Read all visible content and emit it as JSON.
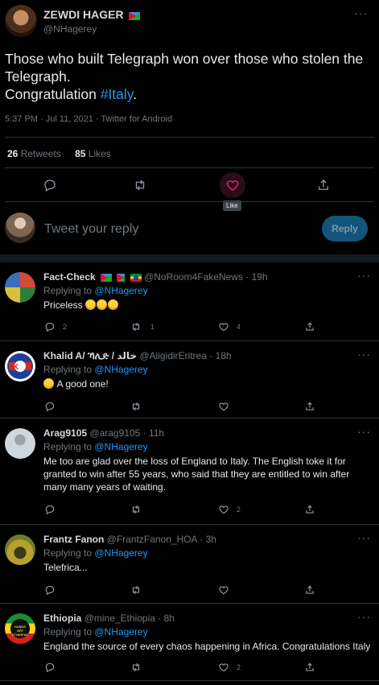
{
  "main_tweet": {
    "author_name": "ZEWDI HAGER",
    "author_handle": "@NHagerey",
    "text_line1": "Those who built Telegraph won over those who stolen the Telegraph.",
    "text_line2_prefix": "Congratulation ",
    "hashtag": "#Italy",
    "text_line2_suffix": ".",
    "timestamp": "5:37 PM · Jul 11, 2021 · Twitter for Android",
    "retweets_count": "26",
    "retweets_label": "Retweets",
    "likes_count": "85",
    "likes_label": "Likes",
    "like_tooltip": "Like",
    "more_icon": "more-dots-icon"
  },
  "reply_box": {
    "placeholder": "Tweet your reply",
    "button_label": "Reply"
  },
  "replies": [
    {
      "name": "Fact-Check",
      "handle": "@NoRoom4FakeNews",
      "time": "· 19h",
      "replying_prefix": "Replying to ",
      "replying_to": "@NHagerey",
      "text": "Priceless",
      "reply_count": "2",
      "retweet_count": "1",
      "like_count": "4",
      "share_count": ""
    },
    {
      "name": "Khalid A/ ኻሊድ / خالد",
      "handle": "@AligidirEritrea",
      "time": "· 18h",
      "replying_prefix": "Replying to ",
      "replying_to": "@NHagerey",
      "text": "A good one!",
      "reply_count": "",
      "retweet_count": "",
      "like_count": "",
      "share_count": ""
    },
    {
      "name": "Arag9105",
      "handle": "@arag9105",
      "time": "· 11h",
      "replying_prefix": "Replying to ",
      "replying_to": "@NHagerey",
      "text": "Me too are glad over the loss of England to Italy. The English toke it for granted to win after 55 years, who said that they are entitled to win after many many years of waiting.",
      "reply_count": "",
      "retweet_count": "",
      "like_count": "2",
      "share_count": ""
    },
    {
      "name": "Frantz Fanon",
      "handle": "@FrantzFanon_HOA",
      "time": "· 3h",
      "replying_prefix": "Replying to ",
      "replying_to": "@NHagerey",
      "text": "Telefrica...",
      "reply_count": "",
      "retweet_count": "",
      "like_count": "",
      "share_count": ""
    },
    {
      "name": "Ethiopia",
      "handle": "@mine_Ethiopia",
      "time": "· 8h",
      "replying_prefix": "Replying to ",
      "replying_to": "@NHagerey",
      "text": "England the source of every chaos happening in Africa. Congratulations Italy",
      "avatar_text": "HANDS OFF ETHIOPIA!",
      "reply_count": "",
      "retweet_count": "",
      "like_count": "2",
      "share_count": ""
    }
  ],
  "colors": {
    "background": "#000000",
    "link": "#1d9bf0",
    "muted": "#6e767d",
    "reply_button": "#11557a",
    "like_highlight": "#f91880"
  }
}
